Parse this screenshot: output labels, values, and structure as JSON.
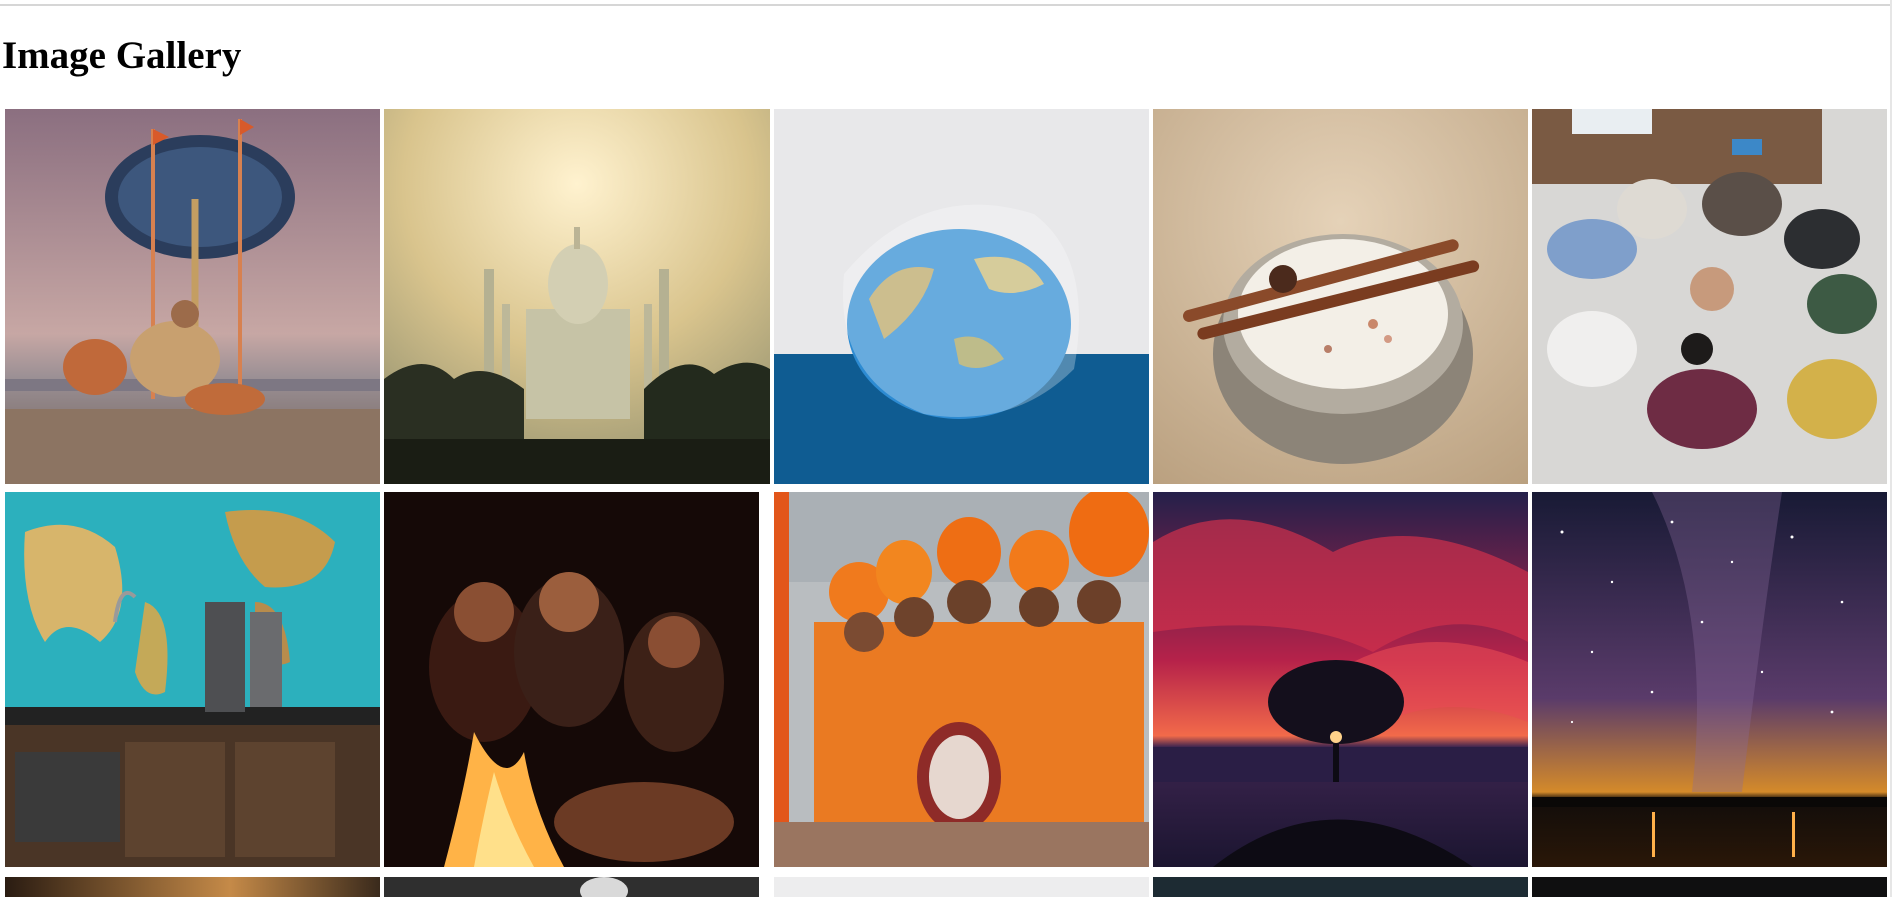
{
  "page": {
    "heading": "Image Gallery"
  },
  "gallery": {
    "rows": [
      [
        {
          "name": "gallery-image-sadhu-umbrella-ghat"
        },
        {
          "name": "gallery-image-taj-mahal-haze"
        },
        {
          "name": "gallery-image-globe-in-plastic-bag"
        },
        {
          "name": "gallery-image-chai-cinnamon-cup"
        },
        {
          "name": "gallery-image-team-hands-together"
        }
      ],
      [
        {
          "name": "gallery-image-world-map-kitchen"
        },
        {
          "name": "gallery-image-friends-by-campfire"
        },
        {
          "name": "gallery-image-musicians-orange-turbans"
        },
        {
          "name": "gallery-image-tree-red-sky-sunset"
        },
        {
          "name": "gallery-image-milky-way-lake"
        }
      ],
      [
        {
          "name": "gallery-image-row3-1"
        },
        {
          "name": "gallery-image-row3-2"
        },
        {
          "name": "gallery-image-row3-3"
        },
        {
          "name": "gallery-image-row3-4"
        },
        {
          "name": "gallery-image-row3-5"
        }
      ]
    ]
  }
}
